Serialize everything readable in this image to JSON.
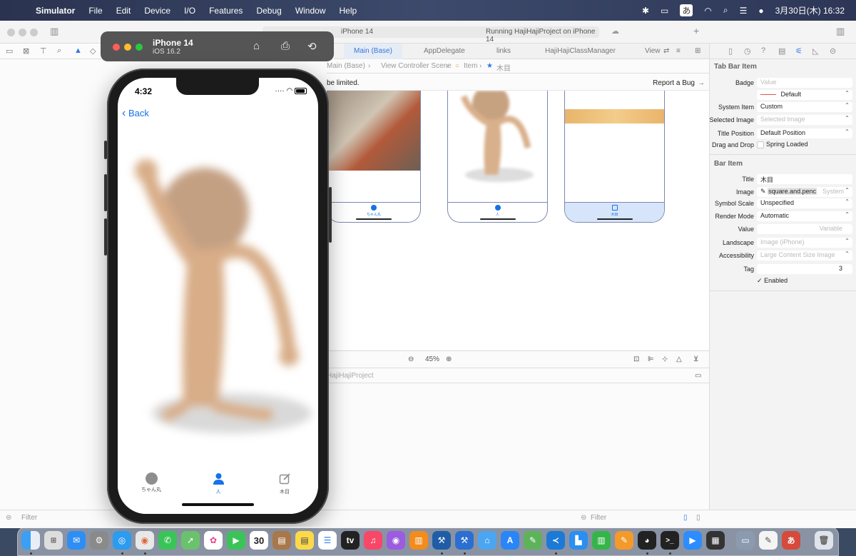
{
  "menubar": {
    "app": "Simulator",
    "items": [
      "File",
      "Edit",
      "Device",
      "I/O",
      "Features",
      "Debug",
      "Window",
      "Help"
    ],
    "input_method": "あ",
    "clock": "3月30日(木) 16:32"
  },
  "xcode": {
    "project_title": "HajiHajiProject",
    "device_chip": "iPhone 14",
    "run_status": "Running HajiHajiProject on iPhone 14",
    "tabs": [
      "Main (Base)",
      "AppDelegate",
      "links",
      "HajiHajiClassManager",
      "View"
    ],
    "jumpbar": [
      "Main (Base)",
      "View Controller Scene",
      "Item",
      "木目"
    ],
    "issue_text": "be limited.",
    "report_bug": "Report a Bug",
    "zoom": "45%",
    "debug_project": "HajiHajiProject",
    "filter_left": "Filter",
    "filter_right": "Filter",
    "scene_labels": [
      "ちゃん丸",
      "人",
      "木目"
    ]
  },
  "inspector": {
    "tab_bar_item_title": "Tab Bar Item",
    "badge_label": "Badge",
    "badge_placeholder": "Value",
    "badge_color": "Default",
    "system_item_label": "System Item",
    "system_item_value": "Custom",
    "selected_image_label": "Selected Image",
    "selected_image_placeholder": "Selected Image",
    "title_position_label": "Title Position",
    "title_position_value": "Default Position",
    "drag_drop_label": "Drag and Drop",
    "spring_loaded": "Spring Loaded",
    "bar_item_title": "Bar Item",
    "title_label": "Title",
    "title_value": "木目",
    "image_label": "Image",
    "image_value": "square.and.penc",
    "image_hint": "System",
    "symbol_scale_label": "Symbol Scale",
    "symbol_scale_value": "Unspecified",
    "render_mode_label": "Render Mode",
    "render_mode_value": "Automatic",
    "value_label": "Value",
    "value_placeholder": "Variable",
    "landscape_label": "Landscape",
    "landscape_placeholder": "Image (iPhone)",
    "accessibility_label": "Accessibility",
    "accessibility_placeholder": "Large Content Size Image",
    "tag_label": "Tag",
    "tag_value": "3",
    "enabled": "Enabled"
  },
  "simulator": {
    "device_name": "iPhone 14",
    "os_version": "iOS 16.2",
    "status_time": "4:32",
    "back_label": "Back",
    "tabs": [
      {
        "label": "ちゃん丸",
        "icon": "circle-icon",
        "color": "#8e8e8e"
      },
      {
        "label": "人",
        "icon": "person-icon",
        "color": "#1572e8"
      },
      {
        "label": "木目",
        "icon": "square-and-pencil-icon",
        "color": "#8e8e8e"
      }
    ],
    "accent": "#1572e8"
  },
  "dock": {
    "calendar_day": "30",
    "apps": [
      "Finder",
      "Launchpad",
      "Mail",
      "System Settings",
      "Safari",
      "Chrome",
      "Messages",
      "Maps",
      "Photos",
      "FaceTime",
      "Calendar",
      "Notes",
      "Reminders",
      "TV",
      "Music",
      "Podcasts",
      "Books",
      "Xcode",
      "Simulator",
      "Xcode Instruments",
      "App Store",
      "Numbers",
      "VS Code",
      "Keynote",
      "Numbers Sheet",
      "Pages",
      "Discord",
      "Terminal",
      "Zoom",
      "Calculator",
      "Preview",
      "TextEdit",
      "Kotoeri",
      "Trash"
    ]
  }
}
